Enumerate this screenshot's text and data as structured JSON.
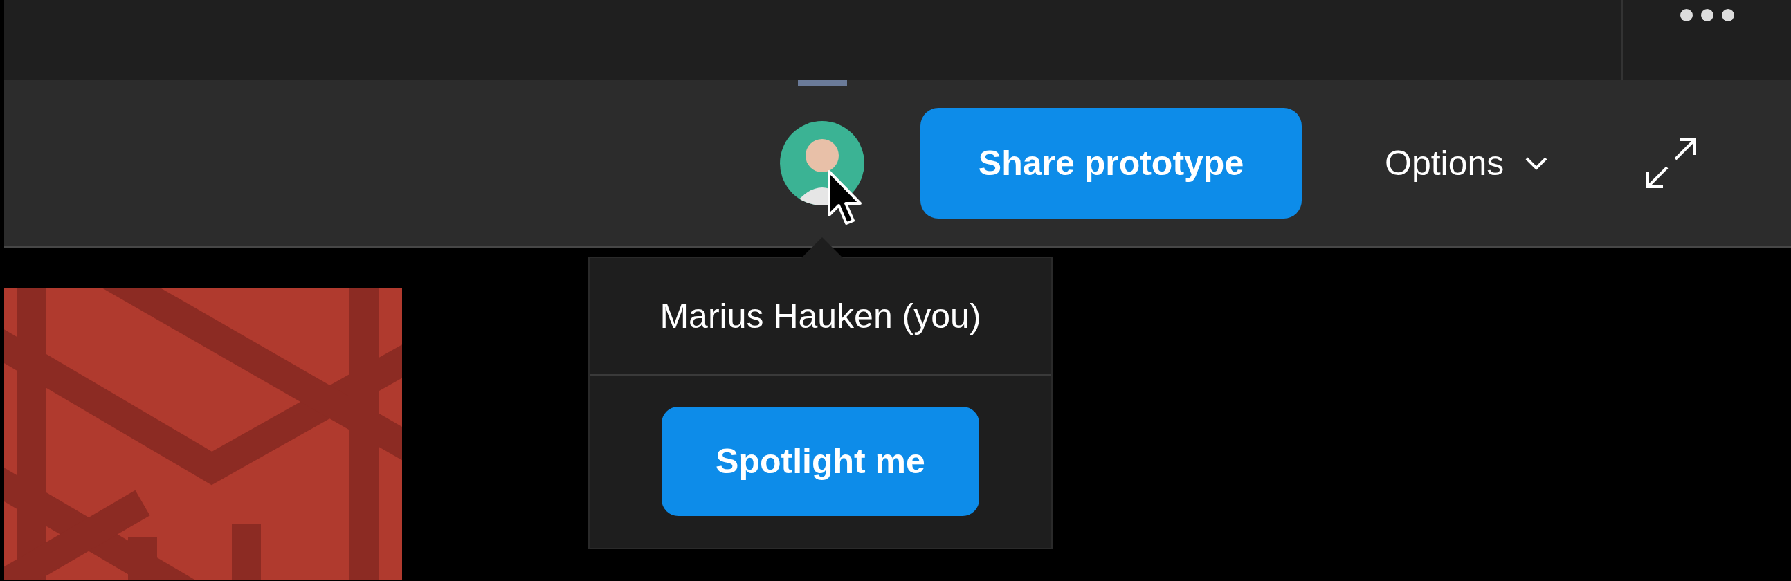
{
  "toolbar": {
    "share_button": "Share prototype",
    "options_menu": "Options"
  },
  "popover": {
    "user_name": "Marius Hauken (you)",
    "spotlight_button": "Spotlight me"
  }
}
